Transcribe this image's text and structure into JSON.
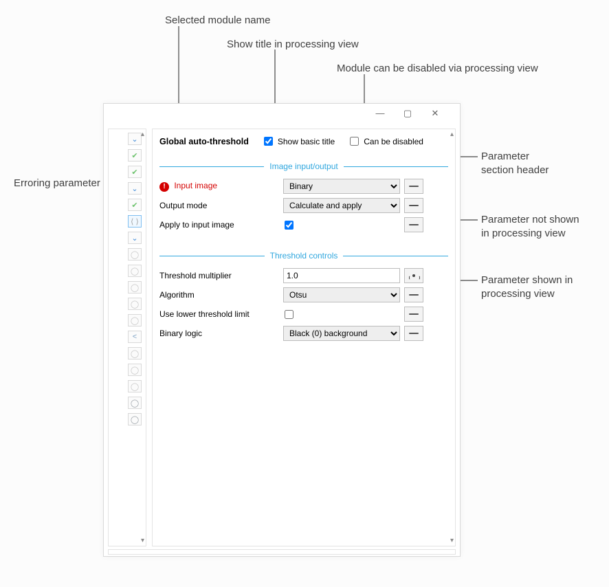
{
  "annotations": {
    "module_name": "Selected module name",
    "show_title": "Show title in processing view",
    "can_disable": "Module can be disabled via processing view",
    "erroring": "Erroring parameter",
    "section_header": "Parameter\nsection header",
    "param_hidden": "Parameter not shown\nin processing view",
    "param_shown": "Parameter shown in\nprocessing view"
  },
  "header": {
    "module_name": "Global auto-threshold",
    "show_basic_title_label": "Show basic title",
    "show_basic_title_checked": true,
    "can_be_disabled_label": "Can be disabled",
    "can_be_disabled_checked": false
  },
  "sections": {
    "io": {
      "title": "Image input/output",
      "params": [
        {
          "label": "Input image",
          "type": "select",
          "value": "Binary",
          "error": true,
          "vis": "hidden"
        },
        {
          "label": "Output mode",
          "type": "select",
          "value": "Calculate and apply",
          "error": false,
          "vis": "hidden"
        },
        {
          "label": "Apply to input image",
          "type": "check",
          "checked": true,
          "error": false,
          "vis": "hidden"
        }
      ]
    },
    "threshold": {
      "title": "Threshold controls",
      "params": [
        {
          "label": "Threshold multiplier",
          "type": "text",
          "value": "1.0",
          "error": false,
          "vis": "shown"
        },
        {
          "label": "Algorithm",
          "type": "select",
          "value": "Otsu",
          "error": false,
          "vis": "hidden"
        },
        {
          "label": "Use lower threshold limit",
          "type": "check",
          "checked": false,
          "error": false,
          "vis": "hidden"
        },
        {
          "label": "Binary logic",
          "type": "select",
          "value": "Black (0) background",
          "error": false,
          "vis": "hidden"
        }
      ]
    }
  }
}
